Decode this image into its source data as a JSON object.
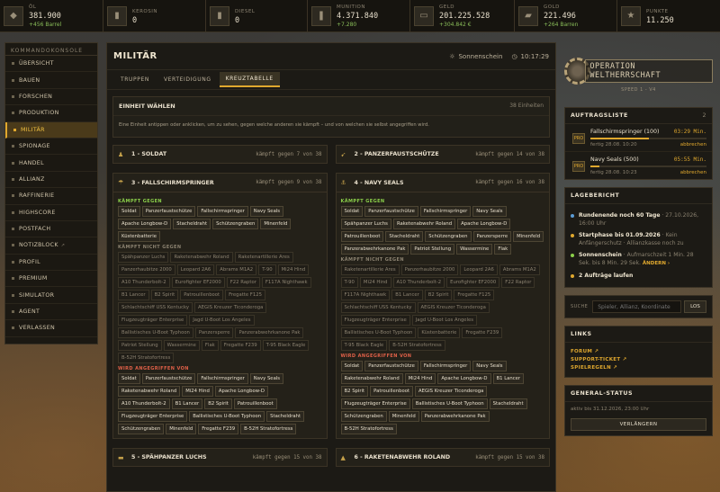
{
  "resources": [
    {
      "icon": "oil-icon",
      "label": "Öl",
      "value": "381.900",
      "sub": "+456 Barrel"
    },
    {
      "icon": "kerosene-icon",
      "label": "Kerosin",
      "value": "0",
      "sub": ""
    },
    {
      "icon": "diesel-icon",
      "label": "Diesel",
      "value": "0",
      "sub": ""
    },
    {
      "icon": "ammunition-icon",
      "label": "Munition",
      "value": "4.371.840",
      "sub": "+7.280"
    },
    {
      "icon": "money-icon",
      "label": "Geld",
      "value": "201.225.528",
      "sub": "+304.842 €"
    },
    {
      "icon": "gold-icon",
      "label": "Gold",
      "value": "221.496",
      "sub": "+264 Barren"
    },
    {
      "icon": "star-icon",
      "label": "Punkte",
      "value": "11.250",
      "sub": ""
    }
  ],
  "sidebar": {
    "title": "KOMMANDOKONSOLE",
    "items": [
      "ÜBERSICHT",
      "BAUEN",
      "FORSCHEN",
      "PRODUKTION",
      "MILITÄR",
      "SPIONAGE",
      "HANDEL",
      "ALLIANZ",
      "RAFFINERIE",
      "HIGHSCORE",
      "POSTFACH",
      "NOTIZBLOCK",
      "PROFIL",
      "PREMIUM",
      "SIMULATOR",
      "AGENT",
      "VERLASSEN"
    ],
    "active_index": 4
  },
  "header": {
    "title": "MILITÄR",
    "weather": "Sonnenschein",
    "time": "10:17:29"
  },
  "tabs": [
    "TRUPPEN",
    "VERTEIDIGUNG",
    "KREUZTABELLE"
  ],
  "unit_select": {
    "title": "EINHEIT WÄHLEN",
    "count": "38 Einheiten",
    "desc": "Eine Einheit antippen oder anklicken, um zu sehen, gegen welche anderen sie kämpft – und von welchen sie selbst angegriffen wird."
  },
  "labels": {
    "fights": "KÄMPFT GEGEN",
    "not_fights": "KÄMPFT NICHT GEGEN",
    "attacked_by": "WIRD ANGEGRIFFEN VON"
  },
  "cards": {
    "c1": {
      "title": "1 - SOLDAT",
      "fights": "kämpft gegen 7 von 38"
    },
    "c2": {
      "title": "2 - PANZERFAUSTSCHÜTZE",
      "fights": "kämpft gegen 14 von 38"
    },
    "c3": {
      "title": "3 - FALLSCHIRMSPRINGER",
      "fights": "kämpft gegen 9 von 38",
      "fights_list": [
        "Soldat",
        "Panzerfaustschütze",
        "Fallschirmspringer",
        "Navy Seals",
        "Apache Longbow-D",
        "Stacheldraht",
        "Schützengraben",
        "Minenfeld",
        "Küstenbatterie"
      ],
      "not_list": [
        "Spähpanzer Luchs",
        "Raketenabwehr Roland",
        "Raketenartillerie Ares",
        "Panzerhaubitze 2000",
        "Leopard 2A6",
        "Abrams M1A2",
        "T-90",
        "Mi24 Hind",
        "A10 Thunderbolt-2",
        "Eurofighter EF2000",
        "F22 Raptor",
        "F117A Nighthawk",
        "B1 Lancer",
        "B2 Spirit",
        "Patrouillenboot",
        "Fregatte F125",
        "Schlachtschiff USS Kentucky",
        "AEGIS Kreuzer Ticonderoga",
        "Flugzeugträger Enterprise",
        "Jagd U-Boot Los Angeles",
        "Ballistisches U-Boot Typhoon",
        "Panzersperre",
        "Panzerabwehrkanone Pak",
        "Patriot Stellung",
        "Wassermine",
        "Flak",
        "Fregatte F239",
        "T-95 Black Eagle",
        "B-52H Stratofortress"
      ],
      "attacked_list": [
        "Soldat",
        "Panzerfaustschütze",
        "Fallschirmspringer",
        "Navy Seals",
        "Raketenabwehr Roland",
        "Mi24 Hind",
        "Apache Longbow-D",
        "A10 Thunderbolt-2",
        "B1 Lancer",
        "B2 Spirit",
        "Patrouillenboot",
        "Flugzeugträger Enterprise",
        "Ballistisches U-Boot Typhoon",
        "Stacheldraht",
        "Schützengraben",
        "Minenfeld",
        "Fregatte F239",
        "B-52H Stratofortress"
      ]
    },
    "c4": {
      "title": "4 - NAVY SEALS",
      "fights": "kämpft gegen 16 von 38",
      "fights_list": [
        "Soldat",
        "Panzerfaustschütze",
        "Fallschirmspringer",
        "Navy Seals",
        "Spähpanzer Luchs",
        "Raketenabwehr Roland",
        "Apache Longbow-D",
        "Patrouillenboot",
        "Stacheldraht",
        "Schützengraben",
        "Panzersperre",
        "Minenfeld",
        "Panzerabwehrkanone Pak",
        "Patriot Stellung",
        "Wassermine",
        "Flak"
      ],
      "not_list": [
        "Raketenartillerie Ares",
        "Panzerhaubitze 2000",
        "Leopard 2A6",
        "Abrams M1A2",
        "T-90",
        "Mi24 Hind",
        "A10 Thunderbolt-2",
        "Eurofighter EF2000",
        "F22 Raptor",
        "F117A Nighthawk",
        "B1 Lancer",
        "B2 Spirit",
        "Fregatte F125",
        "Schlachtschiff USS Kentucky",
        "AEGIS Kreuzer Ticonderoga",
        "Flugzeugträger Enterprise",
        "Jagd U-Boot Los Angeles",
        "Ballistisches U-Boot Typhoon",
        "Küstenbatterie",
        "Fregatte F239",
        "T-95 Black Eagle",
        "B-52H Stratofortress"
      ],
      "attacked_list": [
        "Soldat",
        "Panzerfaustschütze",
        "Fallschirmspringer",
        "Navy Seals",
        "Raketenabwehr Roland",
        "Mi24 Hind",
        "Apache Longbow-D",
        "B1 Lancer",
        "B2 Spirit",
        "Patrouillenboot",
        "AEGIS Kreuzer Ticonderoga",
        "Flugzeugträger Enterprise",
        "Ballistisches U-Boot Typhoon",
        "Stacheldraht",
        "Schützengraben",
        "Minenfeld",
        "Panzerabwehrkanone Pak",
        "B-52H Stratofortress"
      ]
    },
    "c5": {
      "title": "5 - SPÄHPANZER LUCHS",
      "fights": "kämpft gegen 15 von 38"
    },
    "c6": {
      "title": "6 - RAKETENABWEHR ROLAND",
      "fights": "kämpft gegen 15 von 38"
    }
  },
  "logo": {
    "text": "OPERATION WELTHERRSCHAFT",
    "speed": "SPEED 1 - V4"
  },
  "orders": {
    "title": "AUFTRAGSLISTE",
    "count": "2",
    "badge": "PRO",
    "items": [
      {
        "name": "Fallschirmspringer (100)",
        "time": "03:29 Min.",
        "date": "fertig 28.08. 10:20",
        "progress": 0.5,
        "cancel": "abbrechen"
      },
      {
        "name": "Navy Seals (500)",
        "time": "05:55 Min.",
        "date": "fertig 28.08. 10:23",
        "progress": 0.08,
        "cancel": "abbrechen"
      }
    ]
  },
  "report": {
    "title": "LAGEBERICHT",
    "items": [
      {
        "color": "#5b9bd5",
        "bold": "Rundenende noch 60 Tage",
        "rest": " · 27.10.2026, 16:00 Uhr",
        "link": ""
      },
      {
        "color": "#e0a82e",
        "bold": "Startphase bis 01.09.2026",
        "rest": " · Kein Anfängerschutz · Allianzkasse noch zu",
        "link": ""
      },
      {
        "color": "#8bd04a",
        "bold": "Sonnenschein",
        "rest": " · Aufmarschzeit 1 Min. 28 Sek. bis 8 Min. 29 Sek. ",
        "link": "ÄNDERN ›"
      },
      {
        "color": "#e0a82e",
        "bold": "2 Aufträge laufen",
        "rest": "",
        "link": ""
      }
    ]
  },
  "search": {
    "label": "SUCHE",
    "placeholder": "Spieler, Allianz, Koordinate",
    "button": "LOS"
  },
  "links": {
    "title": "LINKS",
    "items": [
      "FORUM ↗",
      "SUPPORT-TICKET ↗",
      "SPIELREGELN ↗"
    ]
  },
  "status": {
    "title": "GENERAL-STATUS",
    "text": "aktiv bis 31.12.2026, 23:00 Uhr",
    "button": "VERLÄNGERN"
  }
}
